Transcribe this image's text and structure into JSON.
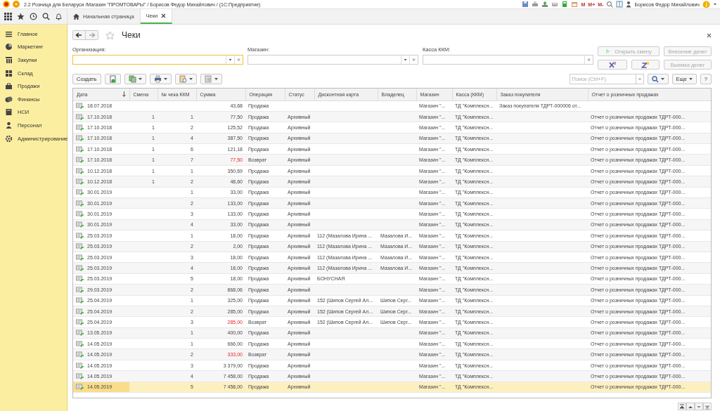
{
  "window": {
    "title": "2.2 Розница для Беларуси /Магазин \"ПРОМТОВАРЫ\" / Борисов Федор Михайлович /  (1С:Предприятие)"
  },
  "toolbar": {
    "memory_buttons": [
      "M",
      "M+",
      "M-"
    ],
    "user": "Борисов Федор Михайлович"
  },
  "sidebar": {
    "items": [
      {
        "label": "Главное"
      },
      {
        "label": "Маркетинг"
      },
      {
        "label": "Закупки"
      },
      {
        "label": "Склад"
      },
      {
        "label": "Продажи"
      },
      {
        "label": "Финансы"
      },
      {
        "label": "НСИ"
      },
      {
        "label": "Персонал"
      },
      {
        "label": "Администрирование"
      }
    ]
  },
  "tabs": [
    {
      "label": "Начальная страница",
      "selected": false
    },
    {
      "label": "Чеки",
      "selected": true
    }
  ],
  "form": {
    "title": "Чеки",
    "filters": [
      {
        "label": "Организация:",
        "focused": true
      },
      {
        "label": "Магазин:",
        "focused": false
      },
      {
        "label": "Касса ККМ:",
        "focused": false
      }
    ],
    "actions": [
      {
        "label": "Открыть смену",
        "kind": "play",
        "disabled": true
      },
      {
        "label": "Внесение денег",
        "kind": "text",
        "disabled": true
      },
      {
        "kind": "x-report",
        "disabled": false
      },
      {
        "kind": "z-report",
        "disabled": false
      },
      {
        "label": "Выемка денег",
        "kind": "text",
        "disabled": true
      }
    ],
    "create_button": "Создать",
    "search": {
      "placeholder": "Поиск (Ctrl+F)"
    },
    "more_button": "Еще",
    "help_button": "?"
  },
  "table": {
    "columns": [
      {
        "label": "Дата",
        "sorted": true
      },
      {
        "label": "Смена",
        "sorted": false
      },
      {
        "label": "№ чека ККМ",
        "sorted": false
      },
      {
        "label": "Сумма",
        "sorted": false
      },
      {
        "label": "Операция",
        "sorted": false
      },
      {
        "label": "Статус",
        "sorted": false
      },
      {
        "label": "Дисконтная карта",
        "sorted": false
      },
      {
        "label": "Владелец",
        "sorted": false
      },
      {
        "label": "Магазин",
        "sorted": false
      },
      {
        "label": "Касса (ККМ)",
        "sorted": false
      },
      {
        "label": "Заказ покупателя",
        "sorted": false
      },
      {
        "label": "Отчет о розничных продажах",
        "sorted": false
      }
    ],
    "rows": [
      {
        "date": "18.07.2018",
        "amount": "43,68",
        "operation": "Продажа",
        "store": "Магазин \"...",
        "register": "ТД \"Комплексн...",
        "order": "Заказ покупателя ТДРТ-000006 от...",
        "kind": "sale",
        "selected": false
      },
      {
        "date": "17.10.2018",
        "shift": "1",
        "number": "1",
        "amount": "77,50",
        "operation": "Продажа",
        "status": "Архивный",
        "store": "Магазин \"...",
        "register": "ТД \"Комплексн...",
        "report": "Отчет о розничных продажах ТДРТ-000...",
        "kind": "sale",
        "selected": false
      },
      {
        "date": "17.10.2018",
        "shift": "1",
        "number": "2",
        "amount": "125,52",
        "operation": "Продажа",
        "status": "Архивный",
        "store": "Магазин \"...",
        "register": "ТД \"Комплексн...",
        "report": "Отчет о розничных продажах ТДРТ-000...",
        "kind": "sale",
        "selected": false
      },
      {
        "date": "17.10.2018",
        "shift": "1",
        "number": "4",
        "amount": "387,50",
        "operation": "Продажа",
        "status": "Архивный",
        "store": "Магазин \"...",
        "register": "ТД \"Комплексн...",
        "report": "Отчет о розничных продажах ТДРТ-000...",
        "kind": "sale",
        "selected": false
      },
      {
        "date": "17.10.2018",
        "shift": "1",
        "number": "6",
        "amount": "121,18",
        "operation": "Продажа",
        "status": "Архивный",
        "store": "Магазин \"...",
        "register": "ТД \"Комплексн...",
        "report": "Отчет о розничных продажах ТДРТ-000...",
        "kind": "sale",
        "selected": false
      },
      {
        "date": "17.10.2018",
        "shift": "1",
        "number": "7",
        "amount": "77,50",
        "operation": "Возврат",
        "status": "Архивный",
        "store": "Магазин \"...",
        "register": "ТД \"Комплексн...",
        "report": "Отчет о розничных продажах ТДРТ-000...",
        "kind": "return",
        "selected": false
      },
      {
        "date": "10.12.2018",
        "shift": "1",
        "number": "1",
        "amount": "350,69",
        "operation": "Продажа",
        "status": "Архивный",
        "store": "Магазин \"...",
        "register": "ТД \"Комплексн...",
        "report": "Отчет о розничных продажах ТДРТ-000...",
        "kind": "sale",
        "selected": false
      },
      {
        "date": "10.12.2018",
        "shift": "1",
        "number": "2",
        "amount": "48,60",
        "operation": "Продажа",
        "status": "Архивный",
        "store": "Магазин \"...",
        "register": "ТД \"Комплексн...",
        "report": "Отчет о розничных продажах ТДРТ-000...",
        "kind": "sale",
        "selected": false
      },
      {
        "date": "30.01.2019",
        "number": "1",
        "amount": "33,00",
        "operation": "Продажа",
        "status": "Архивный",
        "store": "Магазин \"...",
        "register": "ТД \"Комплексн...",
        "report": "Отчет о розничных продажах ТДРТ-000...",
        "kind": "sale",
        "selected": false
      },
      {
        "date": "30.01.2019",
        "number": "2",
        "amount": "133,00",
        "operation": "Продажа",
        "status": "Архивный",
        "store": "Магазин \"...",
        "register": "ТД \"Комплексн...",
        "report": "Отчет о розничных продажах ТДРТ-000...",
        "kind": "sale",
        "selected": false
      },
      {
        "date": "30.01.2019",
        "number": "3",
        "amount": "133,00",
        "operation": "Продажа",
        "status": "Архивный",
        "store": "Магазин \"...",
        "register": "ТД \"Комплексн...",
        "report": "Отчет о розничных продажах ТДРТ-000...",
        "kind": "sale",
        "selected": false
      },
      {
        "date": "30.01.2019",
        "number": "4",
        "amount": "33,00",
        "operation": "Продажа",
        "status": "Архивный",
        "store": "Магазин \"...",
        "register": "ТД \"Комплексн...",
        "report": "Отчет о розничных продажах ТДРТ-000...",
        "kind": "sale",
        "selected": false
      },
      {
        "date": "25.03.2019",
        "number": "1",
        "amount": "18,00",
        "operation": "Продажа",
        "status": "Архивный",
        "card": "112 (Мазалова Ирина ...",
        "owner": "Мазалова И...",
        "store": "Магазин \"...",
        "register": "ТД \"Комплексн...",
        "report": "Отчет о розничных продажах ТДРТ-000...",
        "kind": "sale",
        "selected": false
      },
      {
        "date": "25.03.2019",
        "number": "2",
        "amount": "2,00",
        "operation": "Продажа",
        "status": "Архивный",
        "card": "112 (Мазалова Ирина ...",
        "owner": "Мазалова И...",
        "store": "Магазин \"...",
        "register": "ТД \"Комплексн...",
        "report": "Отчет о розничных продажах ТДРТ-000...",
        "kind": "sale",
        "selected": false
      },
      {
        "date": "25.03.2019",
        "number": "3",
        "amount": "18,00",
        "operation": "Продажа",
        "status": "Архивный",
        "card": "112 (Мазалова Ирина ...",
        "owner": "Мазалова И...",
        "store": "Магазин \"...",
        "register": "ТД \"Комплексн...",
        "report": "Отчет о розничных продажах ТДРТ-000...",
        "kind": "sale",
        "selected": false
      },
      {
        "date": "25.03.2019",
        "number": "4",
        "amount": "18,00",
        "operation": "Продажа",
        "status": "Архивный",
        "card": "112 (Мазалова Ирина ...",
        "owner": "Мазалова И...",
        "store": "Магазин \"...",
        "register": "ТД \"Комплексн...",
        "report": "Отчет о розничных продажах ТДРТ-000...",
        "kind": "sale",
        "selected": false
      },
      {
        "date": "25.03.2019",
        "number": "5",
        "amount": "18,00",
        "operation": "Продажа",
        "status": "Архивный",
        "card": "БОНУСНАЯ",
        "store": "Магазин \"...",
        "register": "ТД \"Комплексн...",
        "report": "Отчет о розничных продажах ТДРТ-000...",
        "kind": "sale",
        "selected": false
      },
      {
        "date": "29.03.2019",
        "number": "2",
        "amount": "868,06",
        "operation": "Продажа",
        "status": "Архивный",
        "store": "Магазин \"...",
        "register": "ТД \"Комплексн...",
        "report": "Отчет о розничных продажах ТДРТ-000...",
        "kind": "sale",
        "selected": false
      },
      {
        "date": "25.04.2019",
        "number": "1",
        "amount": "325,00",
        "operation": "Продажа",
        "status": "Архивный",
        "card": "152 (Шипов Сергей Ал...",
        "owner": "Шипов Серг...",
        "store": "Магазин \"...",
        "register": "ТД \"Комплексн...",
        "report": "Отчет о розничных продажах ТДРТ-000...",
        "kind": "sale",
        "selected": false
      },
      {
        "date": "25.04.2019",
        "number": "2",
        "amount": "285,00",
        "operation": "Продажа",
        "status": "Архивный",
        "card": "152 (Шипов Сергей Ал...",
        "owner": "Шипов Серг...",
        "store": "Магазин \"...",
        "register": "ТД \"Комплексн...",
        "report": "Отчет о розничных продажах ТДРТ-000...",
        "kind": "sale",
        "selected": false
      },
      {
        "date": "25.04.2019",
        "number": "3",
        "amount": "285,00",
        "operation": "Возврат",
        "status": "Архивный",
        "card": "152 (Шипов Сергей Ал...",
        "owner": "Шипов Серг...",
        "store": "Магазин \"...",
        "register": "ТД \"Комплексн...",
        "report": "Отчет о розничных продажах ТДРТ-000...",
        "kind": "return",
        "selected": false
      },
      {
        "date": "13.05.2019",
        "number": "1",
        "amount": "400,00",
        "operation": "Продажа",
        "status": "Архивный",
        "store": "Магазин \"...",
        "register": "ТД \"Комплексн...",
        "report": "Отчет о розничных продажах ТДРТ-000...",
        "kind": "sale",
        "selected": false
      },
      {
        "date": "14.05.2019",
        "number": "1",
        "amount": "666,00",
        "operation": "Продажа",
        "status": "Архивный",
        "store": "Магазин \"...",
        "register": "ТД \"Комплексн...",
        "report": "Отчет о розничных продажах ТДРТ-000...",
        "kind": "sale",
        "selected": false
      },
      {
        "date": "14.05.2019",
        "number": "2",
        "amount": "333,00",
        "operation": "Возврат",
        "status": "Архивный",
        "store": "Магазин \"...",
        "register": "ТД \"Комплексн...",
        "report": "Отчет о розничных продажах ТДРТ-000...",
        "kind": "return",
        "selected": false
      },
      {
        "date": "14.05.2019",
        "number": "3",
        "amount": "3 379,00",
        "operation": "Продажа",
        "status": "Архивный",
        "store": "Магазин \"...",
        "register": "ТД \"Комплексн...",
        "report": "Отчет о розничных продажах ТДРТ-000...",
        "kind": "sale",
        "selected": false
      },
      {
        "date": "14.05.2019",
        "number": "4",
        "amount": "7 458,00",
        "operation": "Продажа",
        "status": "Архивный",
        "store": "Магазин \"...",
        "register": "ТД \"Комплексн...",
        "report": "Отчет о розничных продажах ТДРТ-000...",
        "kind": "sale",
        "selected": false
      },
      {
        "date": "14.05.2019",
        "number": "5",
        "amount": "7 458,00",
        "operation": "Продажа",
        "status": "Архивный",
        "store": "Магазин \"...",
        "register": "ТД \"Комплексн...",
        "report": "Отчет о розничных продажах ТДРТ-000...",
        "kind": "sale",
        "selected": true
      }
    ]
  }
}
